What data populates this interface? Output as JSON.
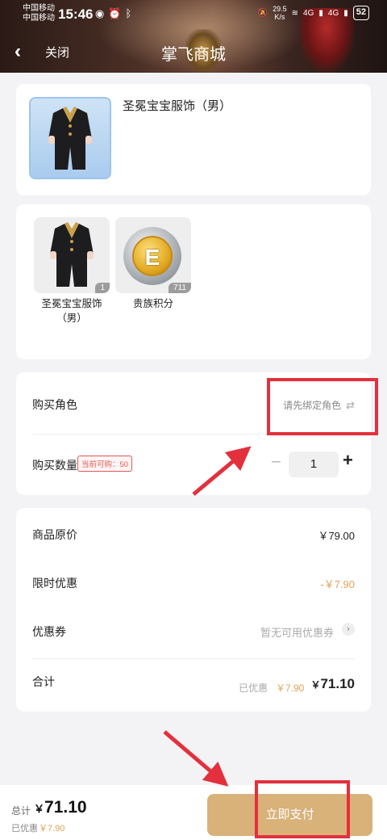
{
  "status_bar": {
    "carrier1": "中国移动",
    "carrier2": "中国移动",
    "time": "15:46",
    "net_speed": "29.5",
    "net_unit": "K/s",
    "signal1": "4G",
    "signal2": "4G",
    "battery": "52"
  },
  "nav": {
    "close_label": "关闭",
    "title": "掌飞商城"
  },
  "product": {
    "name": "圣冕宝宝服饰（男）"
  },
  "items": [
    {
      "label": "圣冕宝宝服饰\n（男）",
      "count": "1"
    },
    {
      "label": "贵族积分",
      "count": "711"
    }
  ],
  "purchase": {
    "role_label": "购买角色",
    "role_value": "请先绑定角色",
    "qty_label": "购买数量",
    "qty_limit": "当前可购：50",
    "qty_minus": "−",
    "qty_value": "1",
    "qty_plus": "+"
  },
  "price": {
    "original_label": "商品原价",
    "original_value": "￥79.00",
    "discount_label": "限时优惠",
    "discount_value": "-￥7.90",
    "coupon_label": "优惠券",
    "coupon_value": "暂无可用优惠券",
    "total_label": "合计",
    "saved_label": "已优惠",
    "saved_value": "￥7.90",
    "total_currency": "￥",
    "total_value": "71.10"
  },
  "bottom": {
    "total_label": "总计",
    "currency": "￥",
    "total_value": "71.10",
    "saved_label": "已优惠",
    "saved_value": "￥7.90",
    "pay_label": "立即支付"
  },
  "colors": {
    "accent_gold": "#d9b27a",
    "discount_orange": "#e1a256",
    "annotation_red": "#e3303d",
    "limit_red": "#e05a5a"
  }
}
